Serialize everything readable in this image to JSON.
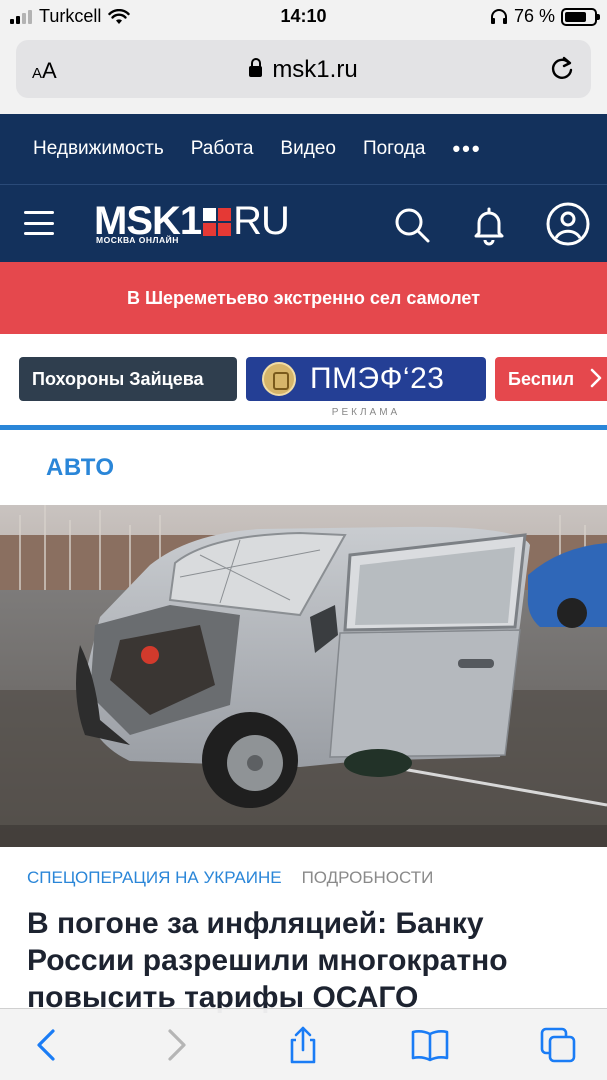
{
  "status_bar": {
    "carrier": "Turkcell",
    "time": "14:10",
    "battery": "76 %",
    "battery_level": 0.76,
    "icons": [
      "signal-icon",
      "wifi-icon",
      "headphones-icon",
      "battery-icon"
    ]
  },
  "browser": {
    "text_size_label": "AA",
    "url": "msk1.ru",
    "icons": [
      "lock-icon",
      "reload-icon"
    ]
  },
  "nav": {
    "items": [
      {
        "label": "Недвижимость"
      },
      {
        "label": "Работа"
      },
      {
        "label": "Видео"
      },
      {
        "label": "Погода"
      }
    ],
    "more": "•••"
  },
  "brand": {
    "logo_left": "MSK1",
    "logo_right": "RU",
    "logo_sub": "МОСКВА ОНЛАЙН",
    "icons": [
      "menu-icon",
      "search-icon",
      "bell-icon",
      "profile-icon"
    ]
  },
  "breaking": {
    "text": "В Шереметьево экстренно сел самолет"
  },
  "chips": {
    "first": "Похороны Зайцева",
    "ad_text": "ПМЭФ‘23",
    "ad_label": "РЕКЛАМА",
    "third": "Беспил"
  },
  "section": {
    "title": "АВТО"
  },
  "article": {
    "rubric": "СПЕЦОПЕРАЦИЯ НА УКРАИНЕ",
    "subrubric": "ПОДРОБНОСТИ",
    "headline": "В погоне за инфляцией: Банку России разрешили многократно повысить тарифы ОСАГО"
  },
  "toolbar": {
    "icons": [
      "back-icon",
      "forward-icon",
      "share-icon",
      "bookmarks-icon",
      "tabs-icon"
    ]
  },
  "colors": {
    "nav_bg": "#13315c",
    "breaking_bg": "#e5484d",
    "accent_blue": "#2a86d8",
    "ad_bg": "#243f95"
  }
}
